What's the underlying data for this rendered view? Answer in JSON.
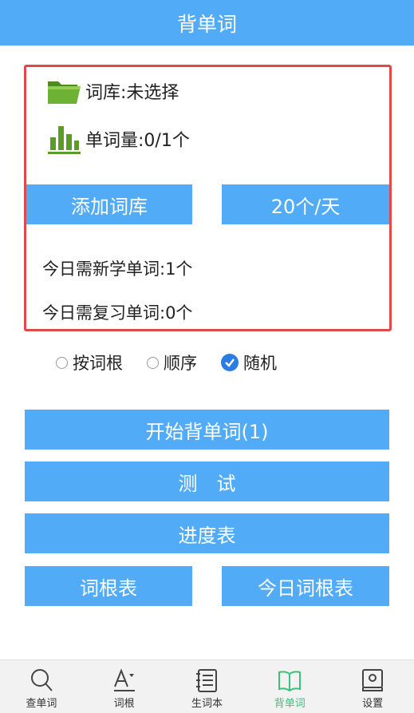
{
  "header": {
    "title": "背单词"
  },
  "panel": {
    "library_label": "词库:未选择",
    "word_count_label": "单词量:0/1个",
    "add_library_button": "添加词库",
    "per_day_button": "20个/天",
    "new_today": "今日需新学单词:1个",
    "review_today": "今日需复习单词:0个"
  },
  "order_options": [
    {
      "label": "按词根",
      "checked": false
    },
    {
      "label": "顺序",
      "checked": false
    },
    {
      "label": "随机",
      "checked": true
    }
  ],
  "actions": {
    "start": "开始背单词(1)",
    "test": "测　试",
    "progress": "进度表",
    "root_table": "词根表",
    "today_root_table": "今日词根表"
  },
  "tabs": [
    {
      "label": "查单词",
      "icon": "search-icon",
      "active": false
    },
    {
      "label": "词根",
      "icon": "font-icon",
      "active": false
    },
    {
      "label": "生词本",
      "icon": "notebook-icon",
      "active": false
    },
    {
      "label": "背单词",
      "icon": "book-icon",
      "active": true
    },
    {
      "label": "设置",
      "icon": "settings-icon",
      "active": false
    }
  ],
  "colors": {
    "primary": "#52abf7",
    "border": "#e14848",
    "active_tab": "#3cc07d",
    "icon_green": "#5c9a2a"
  }
}
